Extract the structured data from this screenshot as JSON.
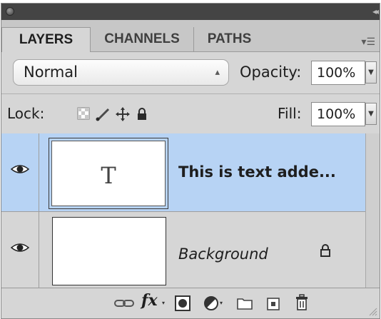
{
  "panel": {
    "tabs": [
      {
        "label": "LAYERS",
        "active": true
      },
      {
        "label": "CHANNELS",
        "active": false
      },
      {
        "label": "PATHS",
        "active": false
      }
    ]
  },
  "blend": {
    "mode": "Normal",
    "opacity_label": "Opacity:",
    "opacity_value": "100%"
  },
  "lock": {
    "label": "Lock:",
    "fill_label": "Fill:",
    "fill_value": "100%",
    "icons": [
      "lock-transparent-pixels-icon",
      "lock-image-pixels-icon",
      "lock-position-icon",
      "lock-all-icon"
    ]
  },
  "layers": [
    {
      "name": "This is text adde...",
      "thumb_glyph": "T",
      "selected": true,
      "visible": true,
      "italic": false,
      "locked": false
    },
    {
      "name": "Background",
      "selected": false,
      "visible": true,
      "italic": true,
      "locked": true
    }
  ],
  "bottom_bar": {
    "icons": [
      "link-layers-icon",
      "fx-icon",
      "add-mask-icon",
      "adjustment-layer-icon",
      "new-group-icon",
      "new-layer-icon",
      "trash-icon"
    ],
    "fx_label": "fx"
  },
  "colors": {
    "panel_bg": "#d6d6d6",
    "selection": "#b7d3f4",
    "titlebar": "#444444"
  }
}
